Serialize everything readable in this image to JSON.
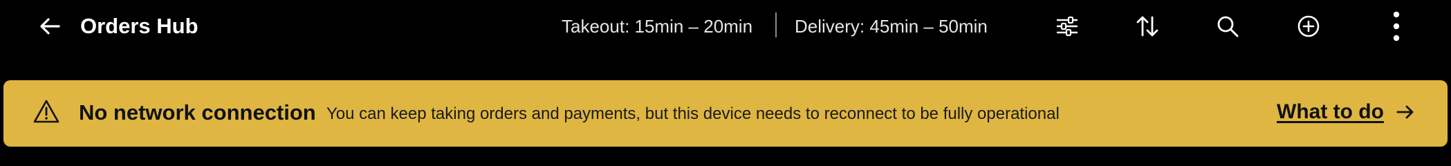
{
  "header": {
    "title": "Orders Hub",
    "takeout_time": "Takeout: 15min – 20min",
    "delivery_time": "Delivery: 45min – 50min",
    "icons": [
      "back-arrow-icon",
      "filter-sliders-icon",
      "sort-icon",
      "search-icon",
      "add-circle-icon",
      "more-vertical-icon"
    ]
  },
  "banner": {
    "title": "No network connection",
    "message": "You can keep taking orders and payments, but this device needs to reconnect to be fully operational",
    "link_label": "What to do",
    "icons": [
      "warning-icon",
      "arrow-right-icon"
    ],
    "background_color": "#dfb641"
  },
  "colors": {
    "app_background": "#000000",
    "header_text": "#ffffff"
  }
}
